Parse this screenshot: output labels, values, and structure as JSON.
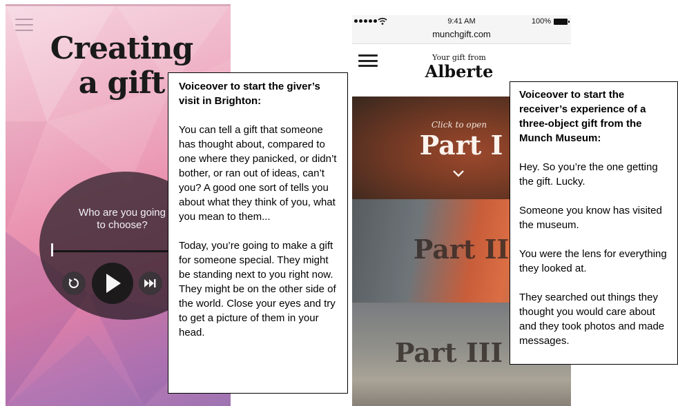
{
  "left_app": {
    "title_line1": "Creating",
    "title_line2": "a gift",
    "menu_icon": "hamburger-icon",
    "player": {
      "prompt_line1": "Who are you going",
      "prompt_line2": "to choose?",
      "replay_icon": "replay-icon",
      "play_icon": "play-icon",
      "next_icon": "skip-forward-icon"
    },
    "colors": {
      "gradient_top": "#f6d4e0",
      "gradient_bottom": "#9e73b2",
      "player_bg": "#281e26"
    }
  },
  "left_callout": {
    "heading": "Voiceover to start the giver’s visit in Brighton:",
    "paragraphs": [
      "You can tell a gift that someone has thought about, compared to one where they panicked, or didn’t bother, or ran out of ideas, can’t you? A good one sort of tells you about what they think of you, what you mean to them...",
      "Today, you’re going to make a gift for someone special. They might be standing next to you right now. They might be on the other side of the world. Close your eyes and try to get a picture of them in your head."
    ]
  },
  "right_app": {
    "status_bar": {
      "time": "9:41 AM",
      "battery": "100%"
    },
    "url": "munchgift.com",
    "header": {
      "gift_from": "Your gift from",
      "giver_name": "Alberte"
    },
    "menu_icon": "hamburger-icon",
    "parts": [
      {
        "hint": "Click to open",
        "label": "Part I",
        "chevron_icon": "chevron-down-icon"
      },
      {
        "label": "Part II"
      },
      {
        "label": "Part III"
      }
    ]
  },
  "right_callout": {
    "heading": "Voiceover to start the receiver’s experience of a three-object gift from the Munch Museum:",
    "paragraphs": [
      "Hey. So you’re the one getting the gift. Lucky.",
      "Someone you know has visited the museum.",
      "You were the lens for everything they looked at.",
      "They searched out things they thought you would care about and they took photos and made messages."
    ]
  }
}
